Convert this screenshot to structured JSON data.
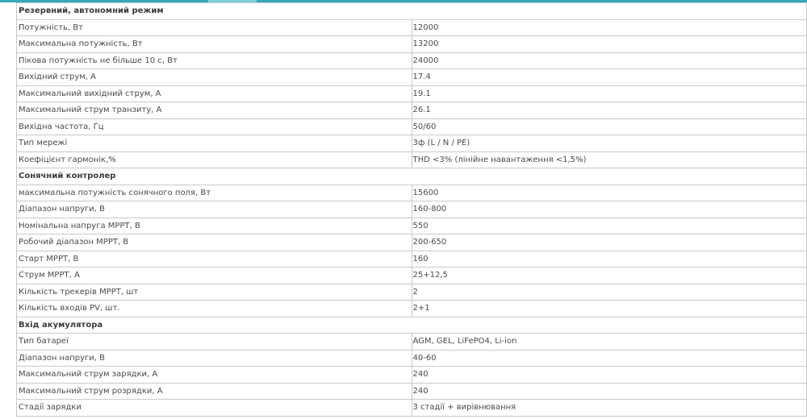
{
  "sections": [
    {
      "title": "Резервний, автономний режим",
      "rows": [
        {
          "label": "Потужність, Вт",
          "value": "12000"
        },
        {
          "label": "Максимальна потужність, Вт",
          "value": "13200"
        },
        {
          "label": "Пікова потужність не більше 10 с, Вт",
          "value": "24000"
        },
        {
          "label": "Вихідний струм, А",
          "value": "17.4"
        },
        {
          "label": "Максимальний вихідний струм, А",
          "value": "19.1"
        },
        {
          "label": "Максимальний струм транзиту, А",
          "value": "26.1"
        },
        {
          "label": "Вихідна частота, Гц",
          "value": "50/60"
        },
        {
          "label": "Тип мережі",
          "value": "3ф (L / N / PE)"
        },
        {
          "label": "Коефіцієнт гармонік,%",
          "value": "THD <3% (лінійне навантаження <1,5%)"
        }
      ]
    },
    {
      "title": "Сонячний контролер",
      "rows": [
        {
          "label": "максимальна потужність сонячного поля, Вт",
          "value": "15600"
        },
        {
          "label": "Діапазон напруги, В",
          "value": "160-800"
        },
        {
          "label": "Номінальна напруга МРРТ, В",
          "value": "550"
        },
        {
          "label": "Робочий діапазон МРРТ, В",
          "value": "200-650"
        },
        {
          "label": "Старт МРРТ, В",
          "value": "160"
        },
        {
          "label": "Струм МРРТ, А",
          "value": "25+12,5"
        },
        {
          "label": "Кількість трекерів МРРТ, шт",
          "value": "2"
        },
        {
          "label": "Кількість входів PV, шт.",
          "value": "2+1"
        }
      ]
    },
    {
      "title": "Вхід акумулятора",
      "rows": [
        {
          "label": "Тип батареї",
          "value": "AGM, GEL, LiFePO4, Li-ion"
        },
        {
          "label": "Діапазон напруги, В",
          "value": "40-60"
        },
        {
          "label": "Максимальний струм зарядки, А",
          "value": "240"
        },
        {
          "label": "Максимальний струм розрядки, А",
          "value": "240"
        },
        {
          "label": "Стадії зарядки",
          "value": "3 стадії + вирівнювання"
        }
      ]
    }
  ]
}
